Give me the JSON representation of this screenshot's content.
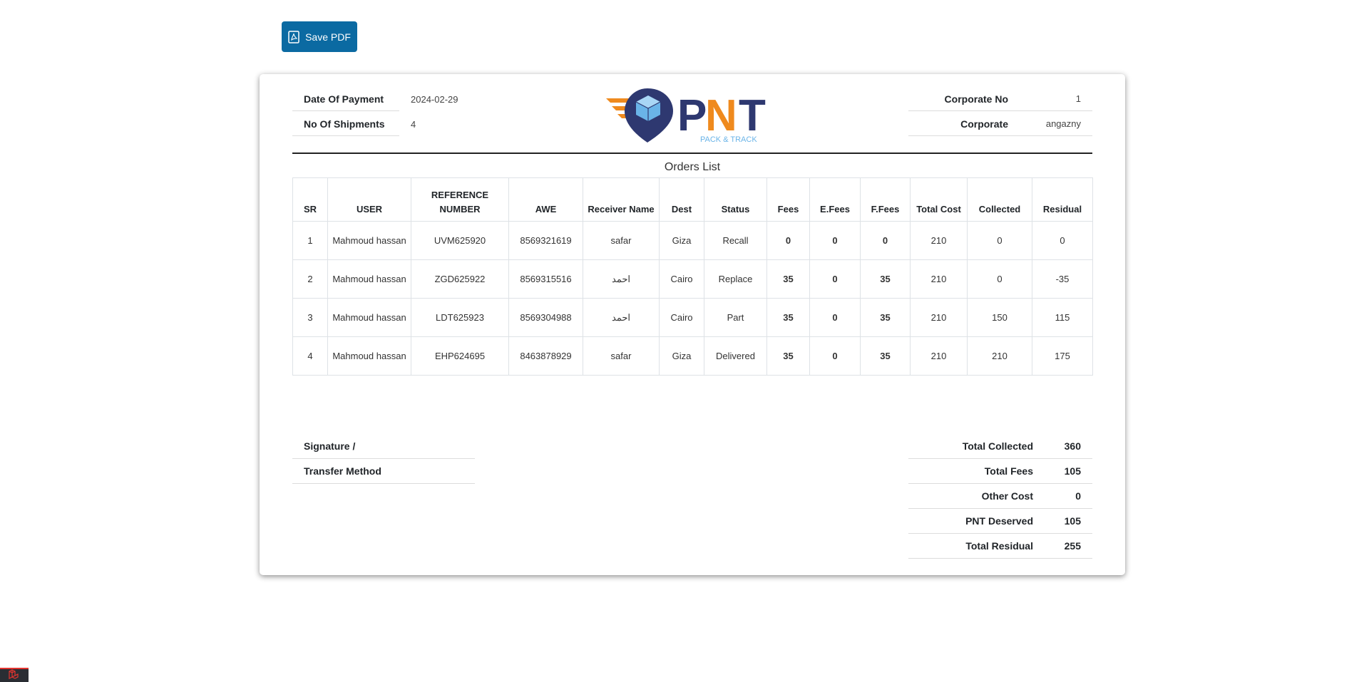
{
  "toolbar": {
    "save_pdf_label": "Save PDF"
  },
  "header": {
    "date_of_payment_label": "Date Of Payment",
    "date_of_payment_value": "2024-02-29",
    "no_of_shipments_label": "No Of Shipments",
    "no_of_shipments_value": "4",
    "corporate_no_label": "Corporate No",
    "corporate_no_value": "1",
    "corporate_label": "Corporate",
    "corporate_value": "angazny"
  },
  "logo": {
    "brand": "PNT",
    "tagline": "PACK & TRACK"
  },
  "orders": {
    "title": "Orders List",
    "columns": [
      "SR",
      "USER",
      "REFERENCE NUMBER",
      "AWE",
      "Receiver Name",
      "Dest",
      "Status",
      "Fees",
      "E.Fees",
      "F.Fees",
      "Total Cost",
      "Collected",
      "Residual"
    ],
    "rows": [
      [
        "1",
        "Mahmoud hassan",
        "UVM625920",
        "8569321619",
        "safar",
        "Giza",
        "Recall",
        "0",
        "0",
        "0",
        "210",
        "0",
        "0"
      ],
      [
        "2",
        "Mahmoud hassan",
        "ZGD625922",
        "8569315516",
        "احمد",
        "Cairo",
        "Replace",
        "35",
        "0",
        "35",
        "210",
        "0",
        "-35"
      ],
      [
        "3",
        "Mahmoud hassan",
        "LDT625923",
        "8569304988",
        "احمد",
        "Cairo",
        "Part",
        "35",
        "0",
        "35",
        "210",
        "150",
        "115"
      ],
      [
        "4",
        "Mahmoud hassan",
        "EHP624695",
        "8463878929",
        "safar",
        "Giza",
        "Delivered",
        "35",
        "0",
        "35",
        "210",
        "210",
        "175"
      ]
    ]
  },
  "footer": {
    "signature_label": "Signature /",
    "transfer_method_label": "Transfer Method",
    "totals": [
      {
        "label": "Total Collected",
        "value": "360"
      },
      {
        "label": "Total Fees",
        "value": "105"
      },
      {
        "label": "Other Cost",
        "value": "0"
      },
      {
        "label": "PNT Deserved",
        "value": "105"
      },
      {
        "label": "Total Residual",
        "value": "255"
      }
    ]
  },
  "colors": {
    "button": "#0b6aa2",
    "brand_navy": "#2e3870",
    "brand_orange": "#ef8a1e",
    "brand_lightblue": "#6ab4e8"
  }
}
